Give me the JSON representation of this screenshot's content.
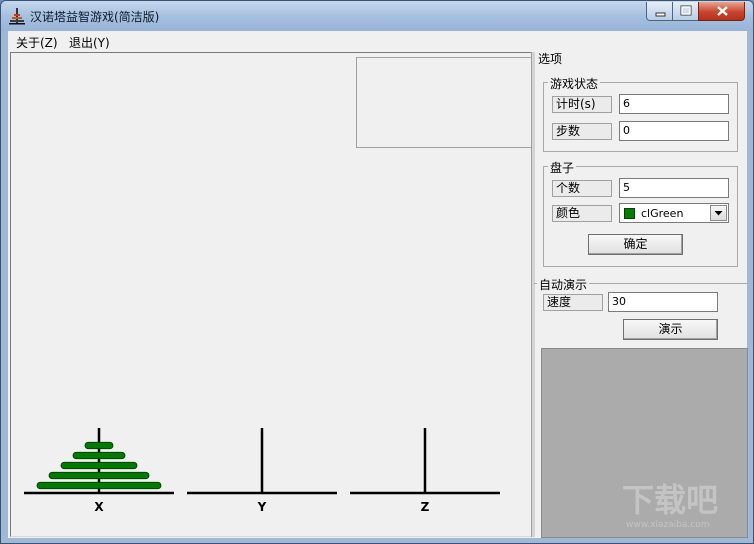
{
  "window": {
    "title": "汉诺塔益智游戏(简洁版)",
    "controls": {
      "minimize": "minimize-icon",
      "maximize": "maximize-icon",
      "close": "close-icon"
    }
  },
  "menu": [
    {
      "label": "关于(Z)"
    },
    {
      "label": "退出(Y)"
    }
  ],
  "board": {
    "pegs": [
      {
        "label": "X",
        "disks": 5
      },
      {
        "label": "Y",
        "disks": 0
      },
      {
        "label": "Z",
        "disks": 0
      }
    ],
    "disk_color": "#007a00",
    "peg_color": "#000000"
  },
  "options": {
    "title": "选项",
    "status": {
      "title": "游戏状态",
      "timer_label": "计时(s)",
      "timer_value": "6",
      "steps_label": "步数",
      "steps_value": "0"
    },
    "disks": {
      "title": "盘子",
      "count_label": "个数",
      "count_value": "5",
      "color_label": "颜色",
      "color_value": "clGreen",
      "color_swatch": "#008000",
      "confirm_label": "确定"
    },
    "demo": {
      "title": "自动演示",
      "speed_label": "速度",
      "speed_value": "30",
      "demo_label": "演示"
    }
  },
  "watermark": {
    "text": "下载吧",
    "url": "www.xiazaiba.com"
  }
}
